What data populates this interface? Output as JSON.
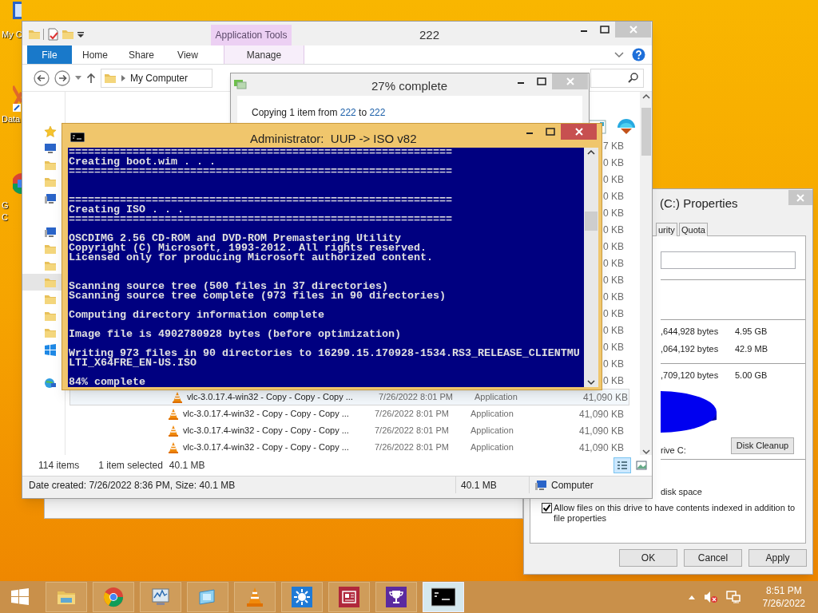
{
  "desktop_icons": [
    {
      "kind": "computer",
      "label_lines": [
        "My C"
      ]
    },
    {
      "kind": "shortcut",
      "label_lines": [
        "Data"
      ]
    },
    {
      "kind": "browser",
      "label_lines": [
        "G",
        "C"
      ]
    }
  ],
  "properties_window": {
    "title": "(C:) Properties",
    "tabs": [
      "urity",
      "Quota"
    ],
    "capacity_rows": [
      {
        "bytes": ",644,928 bytes",
        "size": "4.95 GB"
      },
      {
        "bytes": ",064,192 bytes",
        "size": "42.9 MB"
      },
      {
        "bytes": ",709,120 bytes",
        "size": "5.00 GB"
      }
    ],
    "drive_label": "rive C:",
    "cleanup_button": "Disk Cleanup",
    "compress_label": "disk space",
    "index_option": {
      "label": "Allow files on this drive to have contents indexed in addition to file properties",
      "checked": true
    },
    "buttons": [
      "OK",
      "Cancel",
      "Apply"
    ]
  },
  "explorer": {
    "title": "222",
    "tab_group": "Application Tools",
    "ribbon_tabs": [
      {
        "label": "File",
        "kind": "file"
      },
      {
        "label": "Home",
        "kind": "tab"
      },
      {
        "label": "Share",
        "kind": "tab"
      },
      {
        "label": "View",
        "kind": "tab"
      },
      {
        "label": "Manage",
        "kind": "context"
      }
    ],
    "address": "My Computer",
    "nav_groups": [
      [
        {
          "kind": "star",
          "selected": false
        },
        {
          "kind": "monitor",
          "selected": false
        },
        {
          "kind": "folder",
          "selected": false
        },
        {
          "kind": "folder",
          "selected": false
        },
        {
          "kind": "computer",
          "selected": false
        }
      ],
      [
        {
          "kind": "computer",
          "selected": false
        },
        {
          "kind": "folder",
          "selected": false
        },
        {
          "kind": "folder",
          "selected": false
        },
        {
          "kind": "folder",
          "selected": true
        },
        {
          "kind": "folder",
          "selected": false
        },
        {
          "kind": "folder",
          "selected": false
        },
        {
          "kind": "folder",
          "selected": false
        },
        {
          "kind": "windows",
          "selected": false
        }
      ],
      [
        {
          "kind": "network",
          "selected": false
        }
      ]
    ],
    "file_rows": [
      {
        "size": "7 KB"
      },
      {
        "size": "0 KB"
      },
      {
        "size": "0 KB"
      },
      {
        "size": "0 KB"
      },
      {
        "size": "0 KB"
      },
      {
        "size": "0 KB"
      },
      {
        "size": "0 KB"
      },
      {
        "size": "0 KB"
      },
      {
        "size": "0 KB"
      },
      {
        "size": "0 KB"
      },
      {
        "size": "0 KB"
      },
      {
        "size": "0 KB"
      },
      {
        "size": "0 KB"
      },
      {
        "size": "0 KB"
      },
      {
        "size": "0 KB"
      },
      {
        "name": "vlc-3.0.17.4-win32 - Copy - Copy - Copy ...",
        "date": "7/26/2022 8:01 PM",
        "type": "Application",
        "size": "41,090 KB",
        "selected": true
      },
      {
        "name": "vlc-3.0.17.4-win32 - Copy - Copy - Copy ...",
        "date": "7/26/2022 8:01 PM",
        "type": "Application",
        "size": "41,090 KB",
        "selected": false
      },
      {
        "name": "vlc-3.0.17.4-win32 - Copy - Copy - Copy ...",
        "date": "7/26/2022 8:01 PM",
        "type": "Application",
        "size": "41,090 KB",
        "selected": false
      },
      {
        "name": "vlc-3.0.17.4-win32 - Copy - Copy - Copy ...",
        "date": "7/26/2022 8:01 PM",
        "type": "Application",
        "size": "41,090 KB",
        "selected": false
      }
    ],
    "status": {
      "item_count": "114 items",
      "selection": "1 item selected",
      "selection_size": "40.1 MB"
    },
    "view_buttons": [
      {
        "kind": "details",
        "selected": true
      },
      {
        "kind": "thumbnails",
        "selected": false
      }
    ],
    "details_bar": {
      "info": "Date created: 7/26/2022 8:36 PM, Size: 40.1 MB",
      "size": "40.1 MB",
      "location": "Computer"
    }
  },
  "copy_dialog": {
    "title": "27% complete",
    "prefix": "Copying 1 item from",
    "source": "222",
    "middle": "to",
    "destination": "222"
  },
  "console": {
    "title": "Administrator:  UUP -> ISO v82",
    "lines": [
      {
        "kind": "text",
        "text": "============================================================"
      },
      {
        "kind": "text",
        "text": "Creating boot.wim . . ."
      },
      {
        "kind": "text",
        "text": "============================================================"
      },
      {
        "kind": "blank"
      },
      {
        "kind": "blank"
      },
      {
        "kind": "text",
        "text": "============================================================"
      },
      {
        "kind": "text",
        "text": "Creating ISO . . ."
      },
      {
        "kind": "text",
        "text": "============================================================"
      },
      {
        "kind": "blank"
      },
      {
        "kind": "text",
        "text": "OSCDIMG 2.56 CD-ROM and DVD-ROM Premastering Utility"
      },
      {
        "kind": "text",
        "text": "Copyright (C) Microsoft, 1993-2012. All rights reserved."
      },
      {
        "kind": "text",
        "text": "Licensed only for producing Microsoft authorized content."
      },
      {
        "kind": "blank"
      },
      {
        "kind": "blank"
      },
      {
        "kind": "text",
        "text": "Scanning source tree (500 files in 37 directories)"
      },
      {
        "kind": "text",
        "text": "Scanning source tree complete (973 files in 90 directories)"
      },
      {
        "kind": "blank"
      },
      {
        "kind": "text",
        "text": "Computing directory information complete"
      },
      {
        "kind": "blank"
      },
      {
        "kind": "text",
        "text": "Image file is 4902780928 bytes (before optimization)"
      },
      {
        "kind": "blank"
      },
      {
        "kind": "text",
        "text": "Writing 973 files in 90 directories to 16299.15.170928-1534.RS3_RELEASE_CLIENTMU"
      },
      {
        "kind": "text",
        "text": "LTI_X64FRE_EN-US.ISO"
      },
      {
        "kind": "blank"
      },
      {
        "kind": "text",
        "text": "84% complete"
      }
    ]
  },
  "taskbar": {
    "items": [
      {
        "kind": "explorer",
        "active": false
      },
      {
        "kind": "chrome",
        "active": false
      },
      {
        "kind": "monitor",
        "active": false
      },
      {
        "kind": "window",
        "active": false
      },
      {
        "kind": "cone",
        "active": false
      },
      {
        "kind": "sun",
        "active": false
      },
      {
        "kind": "news",
        "active": false
      },
      {
        "kind": "trophy",
        "active": false
      },
      {
        "kind": "console",
        "active": true
      }
    ],
    "time": "8:51 PM",
    "date": "7/26/2022"
  }
}
